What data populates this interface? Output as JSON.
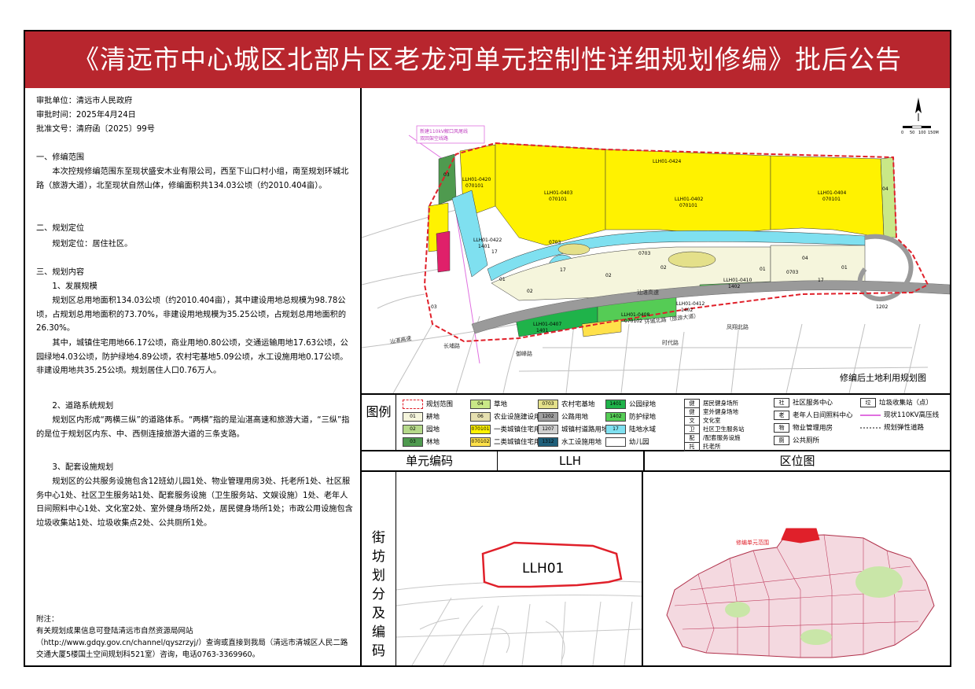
{
  "title": "《清远市中心城区北部片区老龙河单元控制性详细规划修编》批后公告",
  "approval": {
    "unit": "审批单位：清远市人民政府",
    "time": "审批时间：2025年4月24日",
    "doc_no": "批准文号：清府函〔2025〕99号"
  },
  "sections": {
    "s1_head": "一、修编范围",
    "s1_text": "本次控规修编范围东至现状盛安木业有限公司，西至下山口村小组，南至规划环城北路（旅游大道），北至现状自然山体，修编面积共134.03公顷（约2010.404亩）。",
    "s2_head": "二、规划定位",
    "s2_text": "规划定位：居住社区。",
    "s3_head": "三、规划内容",
    "s3_1_head": "1、发展规模",
    "s3_1_text_a": "规划区总用地面积134.03公顷（约2010.404亩），其中建设用地总规模为98.78公顷，占规划总用地面积的73.70%，非建设用地规模为35.25公顷，占规划总用地面积的26.30%。",
    "s3_1_text_b": "其中，城镇住宅用地66.17公顷，商业用地0.80公顷，交通运输用地17.63公顷，公园绿地4.03公顷，防护绿地4.89公顷，农村宅基地5.09公顷，水工设施用地0.17公顷。非建设用地共35.25公顷。规划居住人口0.76万人。",
    "s3_2_head": "2、道路系统规划",
    "s3_2_text": "规划区内形成“两横三纵”的道路体系。“两横”指的是汕湛高速和旅游大道，“三纵”指的是位于规划区内东、中、西侧连接旅游大道的三条支路。",
    "s3_3_head": "3、配套设施规划",
    "s3_3_text": "规划区的公共服务设施包含12班幼儿园1处、物业管理用房3处、托老所1处、社区服务中心1处、社区卫生服务站1处、配套服务设施（卫生服务站、文娱设施）1处、老年人日间照料中心1处、文化室2处、室外健身场所2处，居民健身场所1处；市政公用设施包含垃圾收集站1处、垃圾收集点2处、公共厕所1处。"
  },
  "appendix": {
    "head": "附注：",
    "line1": "有关规划成果信息可登陆清远市自然资源局网站",
    "line2": "（http://www.gdqy.gov.cn/channel/qyszrzyj/）查询或直接到我局（清远市清城区人民二路交通大厦5楼国土空间规划科521室）咨询，电话0763-3369960。"
  },
  "map": {
    "caption": "修编后土地利用规划图",
    "annot_line1": "新建110kV解口风尾线",
    "annot_line2": "双回架空线路",
    "roads": {
      "shanzhan": "汕湛高速",
      "shanzhan_left": "汕湛高速",
      "huancheng": "环城北路（旅游大道）",
      "changpu": "长埔路",
      "yufeng": "御峰路",
      "shidai": "时代路",
      "fengxiang": "凤翔北路"
    },
    "parcels": [
      {
        "code": "LLH01-0403",
        "use": "070101"
      },
      {
        "code": "LLH01-0402",
        "use": "070101"
      },
      {
        "code": "LLH01-0404",
        "use": "070101"
      },
      {
        "code": "LLH01-0424",
        "use": ""
      },
      {
        "code": "LLH01-0420",
        "use": "070101"
      },
      {
        "code": "LLH01-0422",
        "use": "1401"
      },
      {
        "code": "LLH01-0407",
        "use": "1401"
      },
      {
        "code": "LLH01-0408",
        "use": "070102"
      },
      {
        "code": "LLH01-0410",
        "use": "1402"
      },
      {
        "code": "LLH01-0412",
        "use": "1402"
      }
    ],
    "small_labels": [
      "03",
      "04",
      "01",
      "02",
      "17",
      "0703",
      "1202",
      "04",
      "01",
      "0703",
      "02",
      "0703",
      "03",
      "17",
      "02",
      "17",
      "01"
    ],
    "scale_ticks": [
      "0",
      "50",
      "100",
      "150M"
    ]
  },
  "legend": {
    "title": "图例",
    "items": [
      {
        "code": "",
        "label": "规划范围",
        "color": "#ffffff"
      },
      {
        "code": "01",
        "label": "耕地",
        "color": "#f5f5dc"
      },
      {
        "code": "02",
        "label": "园地",
        "color": "#b5d98a"
      },
      {
        "code": "03",
        "label": "林地",
        "color": "#4f9a4f"
      },
      {
        "code": "04",
        "label": "草地",
        "color": "#c9e887"
      },
      {
        "code": "06",
        "label": "农业设施建设用地",
        "color": "#e6e0b0"
      },
      {
        "code": "070101",
        "label": "一类城镇住宅用地",
        "color": "#fff200"
      },
      {
        "code": "070102",
        "label": "二类城镇住宅用地",
        "color": "#ffe14a"
      },
      {
        "code": "0703",
        "label": "农村宅基地",
        "color": "#e4e08a"
      },
      {
        "code": "1202",
        "label": "公路用地",
        "color": "#a0a0a0"
      },
      {
        "code": "1207",
        "label": "城镇村道路用地",
        "color": "#d0d0d0"
      },
      {
        "code": "1312",
        "label": "水工设施用地",
        "color": "#1f5f7a"
      },
      {
        "code": "1401",
        "label": "公园绿地",
        "color": "#1fb34a"
      },
      {
        "code": "1402",
        "label": "防护绿地",
        "color": "#55cc55"
      },
      {
        "code": "17",
        "label": "陆地水域",
        "color": "#7fe0f0"
      },
      {
        "code": "",
        "label": "幼儿园",
        "color": "#ffffff"
      }
    ],
    "facilities": [
      {
        "icon": "健",
        "label": "居民健身场所"
      },
      {
        "icon": "健",
        "label": "室外健身场地"
      },
      {
        "icon": "文",
        "label": "文化室"
      },
      {
        "icon": "卫",
        "label": "社区卫生服务站"
      },
      {
        "icon": "配",
        "label": "/配套服务设施"
      },
      {
        "icon": "托",
        "label": "托老所"
      },
      {
        "icon": "社",
        "label": "社区服务中心"
      },
      {
        "icon": "老",
        "label": "老年人日间照料中心"
      },
      {
        "icon": "物",
        "label": "物业管理用房"
      },
      {
        "icon": "厕",
        "label": "公共厕所"
      },
      {
        "icon": "垃",
        "label": "垃圾收集站（点）"
      },
      {
        "icon": "",
        "label": "现状110KV高压线"
      },
      {
        "icon": "",
        "label": "规划弹性道路"
      }
    ]
  },
  "grid": {
    "col1": "单元编码",
    "col2": "LLH",
    "col3": "区位图",
    "vertical": "街坊划分及编码",
    "unit_label": "LLH01",
    "loc_label": "修编单元范围"
  },
  "colors": {
    "title_bar": "#b8262e",
    "boundary": "#e0202a"
  }
}
